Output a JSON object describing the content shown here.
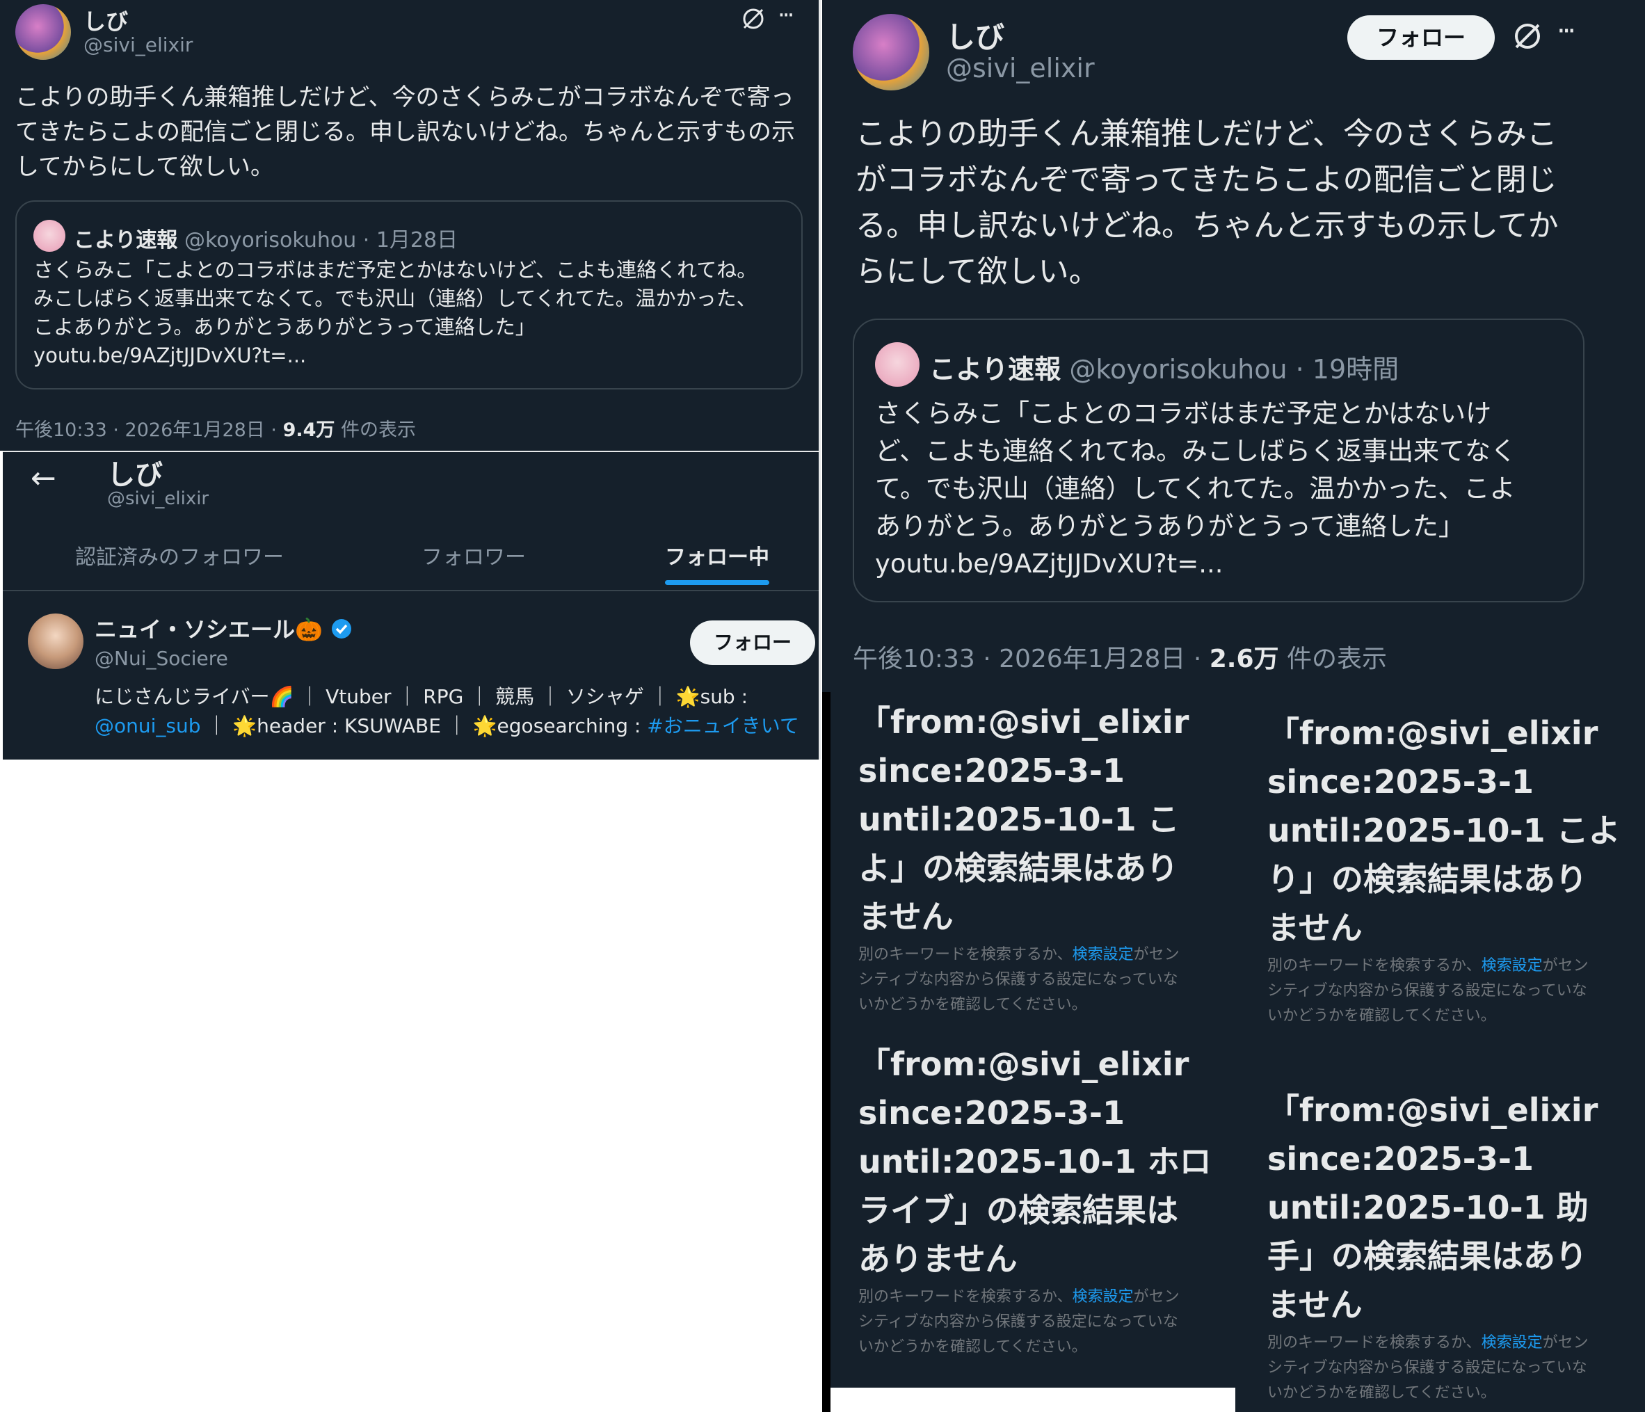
{
  "tweet_small": {
    "user_name": "しび",
    "user_handle": "@sivi_elixir",
    "text_lines": [
      "こよりの助手くん兼箱推しだけど、今のさくらみこがコラボなんぞで寄っ",
      "てきたらこよの配信ごと閉じる。申し訳ないけどね。ちゃんと示すもの示",
      "してからにして欲しい。"
    ],
    "quote": {
      "name": "こより速報",
      "handle": "@koyorisokuhou",
      "time": "· 1月28日",
      "lines": [
        "さくらみこ「こよとのコラボはまだ予定とかはないけど、こよも連絡くれてね。",
        "みこしばらく返事出来てなくて。でも沢山（連絡）してくれてた。温かかった、",
        "こよありがとう。ありがとうありがとうって連絡した」",
        "youtu.be/9AZjtJJDvXU?t=..."
      ]
    },
    "meta_time": "午後10:33 · 2026年1月28日 · ",
    "meta_views": "9.4万",
    "meta_suffix": " 件の表示",
    "more": "···"
  },
  "profile": {
    "name": "しび",
    "handle": "@sivi_elixir",
    "back": "←",
    "tabs": [
      "認証済みのフォロワー",
      "フォロワー",
      "フォロー中"
    ],
    "user": {
      "name": "ニュイ・ソシエール🎃",
      "handle": "@Nui_Sociere",
      "follow_label": "フォロー",
      "bio_line1": "にじさんじライバー🌈 ｜ Vtuber ｜ RPG ｜ 競馬 ｜ ソシャゲ ｜ 🌟sub :",
      "bio_line2_link1": "@onui_sub",
      "bio_line2_mid": " ｜ 🌟header : KSUWABE ｜ 🌟egosearching : ",
      "bio_line2_link2": "#おニュイきいて"
    }
  },
  "tweet_large": {
    "user_name": "しび",
    "user_handle": "@sivi_elixir",
    "follow_label": "フォロー",
    "more": "···",
    "text_lines": [
      "こよりの助手くん兼箱推しだけど、今のさくらみこ",
      "がコラボなんぞで寄ってきたらこよの配信ごと閉じ",
      "る。申し訳ないけどね。ちゃんと示すもの示してか",
      "らにして欲しい。"
    ],
    "quote": {
      "name": "こより速報",
      "handle": "@koyorisokuhou",
      "time": "· 19時間",
      "lines": [
        "さくらみこ「こよとのコラボはまだ予定とかはないけ",
        "ど、こよも連絡くれてね。みこしばらく返事出来てなく",
        "て。でも沢山（連絡）してくれてた。温かかった、こよ",
        "ありがとう。ありがとうありがとうって連絡した」",
        "youtu.be/9AZjtJJDvXU?t=..."
      ]
    },
    "meta_time": "午後10:33 · 2026年1月28日 · ",
    "meta_views": "2.6万",
    "meta_suffix": " 件の表示"
  },
  "search_results": [
    {
      "title_lines": [
        "「from:@sivi_elixir",
        "since:2025-3-1",
        "until:2025-10-1 こ",
        "よ」の検索結果はあり",
        "ません"
      ],
      "sub_pre": "別のキーワードを検索するか、",
      "sub_link": "検索設定",
      "sub_post1": "がセン",
      "sub_line2": "シティブな内容から保護する設定になっていな",
      "sub_line3": "いかどうかを確認してください。"
    },
    {
      "title_lines": [
        "「from:@sivi_elixir",
        "since:2025-3-1",
        "until:2025-10-1 こよ",
        "り」の検索結果はあり",
        "ません"
      ],
      "sub_pre": "別のキーワードを検索するか、",
      "sub_link": "検索設定",
      "sub_post1": "がセン",
      "sub_line2": "シティブな内容から保護する設定になっていな",
      "sub_line3": "いかどうかを確認してください。"
    },
    {
      "title_lines": [
        "「from:@sivi_elixir",
        "since:2025-3-1",
        "until:2025-10-1 ホロ",
        "ライブ」の検索結果は",
        "ありません"
      ],
      "sub_pre": "別のキーワードを検索するか、",
      "sub_link": "検索設定",
      "sub_post1": "がセン",
      "sub_line2": "シティブな内容から保護する設定になっていな",
      "sub_line3": "いかどうかを確認してください。"
    },
    {
      "title_lines": [
        "「from:@sivi_elixir",
        "since:2025-3-1",
        "until:2025-10-1 助",
        "手」の検索結果はあり",
        "ません"
      ],
      "sub_pre": "別のキーワードを検索するか、",
      "sub_link": "検索設定",
      "sub_post1": "がセン",
      "sub_line2": "シティブな内容から保護する設定になっていな",
      "sub_line3": "いかどうかを確認してください。"
    }
  ],
  "colors": {
    "background": "#15202b",
    "text": "#e7e9ea",
    "muted": "#8b98a5",
    "link": "#1d9bf0",
    "border": "#38444d"
  },
  "icons": [
    "grok-icon",
    "more-icon",
    "back-arrow-icon",
    "verified-badge-icon"
  ]
}
